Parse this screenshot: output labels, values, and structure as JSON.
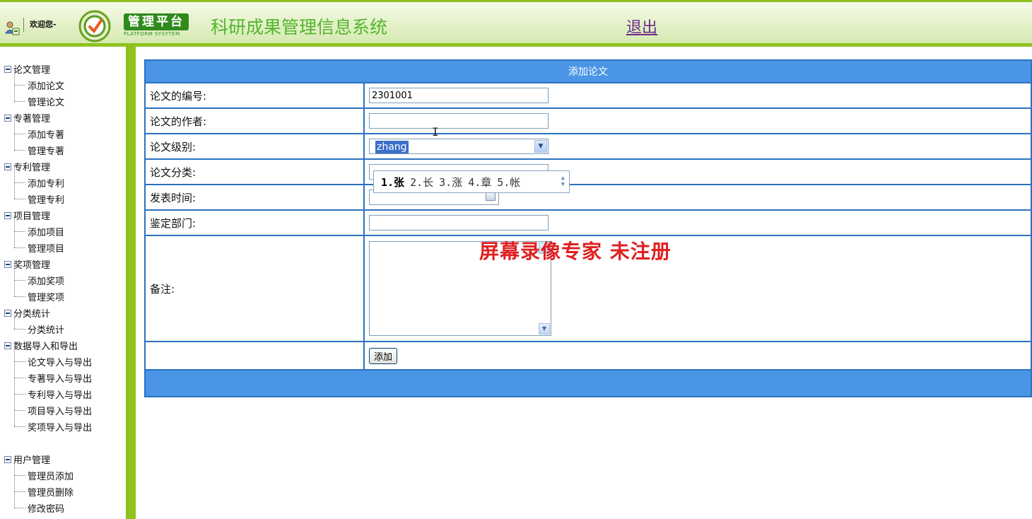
{
  "header": {
    "welcome": "欢迎您-",
    "platform": "管理平台",
    "platform_sub": "PLATFORM SYSYTEM",
    "system_title": "科研成果管理信息系统",
    "logout": "退出"
  },
  "sidebar": {
    "groups": [
      {
        "title": "论文管理",
        "items": [
          "添加论文",
          "管理论文"
        ]
      },
      {
        "title": "专著管理",
        "items": [
          "添加专著",
          "管理专著"
        ]
      },
      {
        "title": "专利管理",
        "items": [
          "添加专利",
          "管理专利"
        ]
      },
      {
        "title": "项目管理",
        "items": [
          "添加项目",
          "管理项目"
        ]
      },
      {
        "title": "奖项管理",
        "items": [
          "添加奖项",
          "管理奖项"
        ]
      },
      {
        "title": "分类统计",
        "items": [
          "分类统计"
        ]
      },
      {
        "title": "数据导入和导出",
        "items": [
          "论文导入与导出",
          "专著导入与导出",
          "专利导入与导出",
          "项目导入与导出",
          "奖项导入与导出"
        ]
      },
      {
        "title": "用户管理",
        "items": [
          "管理员添加",
          "管理员删除",
          "修改密码"
        ]
      }
    ]
  },
  "form": {
    "title": "添加论文",
    "rows": {
      "number": {
        "label": "论文的编号:",
        "value": "2301001"
      },
      "author": {
        "label": "论文的作者:",
        "value": ""
      },
      "level": {
        "label": "论文级别:",
        "ime_text": "zhang"
      },
      "category": {
        "label": "论文分类:"
      },
      "publish_time": {
        "label": "发表时间:"
      },
      "department": {
        "label": "鉴定部门:"
      },
      "remarks": {
        "label": "备注:"
      }
    },
    "submit_label": "添加"
  },
  "ime": {
    "candidates": [
      "1.张",
      "2.长",
      "3.涨",
      "4.章",
      "5.帐"
    ]
  },
  "watermark": "屏幕录像专家  未注册"
}
